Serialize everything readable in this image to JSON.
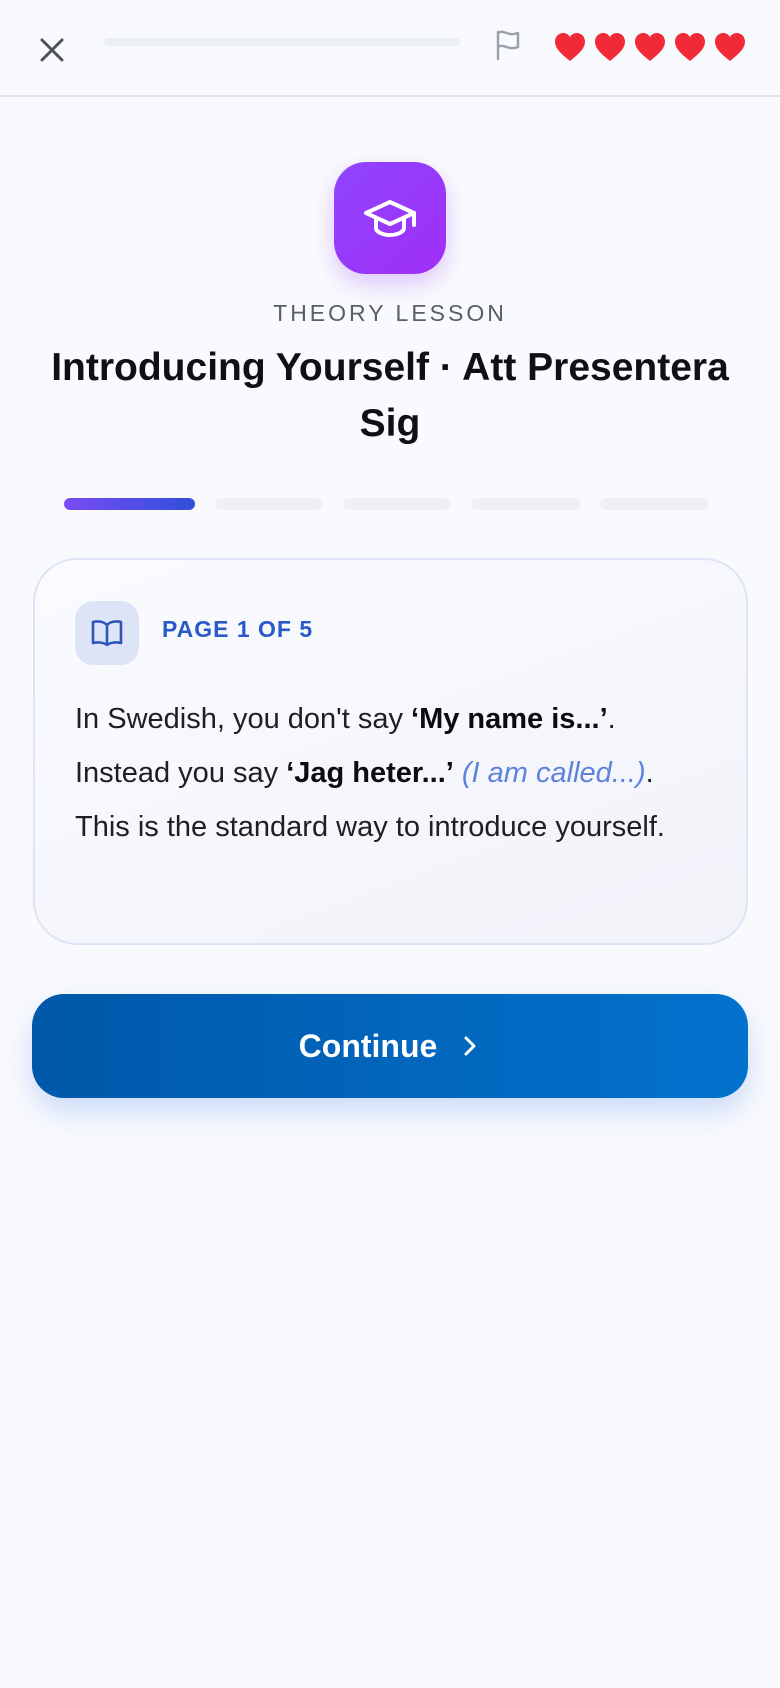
{
  "topbar": {
    "close_icon": "close-icon",
    "progress_value": 0.0,
    "flag_icon": "flag-icon",
    "hearts_count": 5,
    "heart_color": "#f02a36"
  },
  "header": {
    "icon": "graduation-cap-icon",
    "icon_color": "#9a37f8",
    "eyebrow": "THEORY LESSON",
    "title": "Introducing Yourself · Att Presentera Sig"
  },
  "pages": {
    "current": 1,
    "total": 5
  },
  "card": {
    "icon": "open-book-icon",
    "page_label": "PAGE 1 OF 5",
    "body": {
      "t1": "In Swedish, you don't say ",
      "b1": "‘My name is...’",
      "t2": ". Instead you say ",
      "b2": "‘Jag heter...’",
      "t3": " ",
      "i1": "(I am called...)",
      "t4": ". This is the standard way to introduce yourself."
    }
  },
  "continue_button": {
    "label": "Continue",
    "icon": "chevron-right-icon",
    "color": "#0064bb"
  }
}
